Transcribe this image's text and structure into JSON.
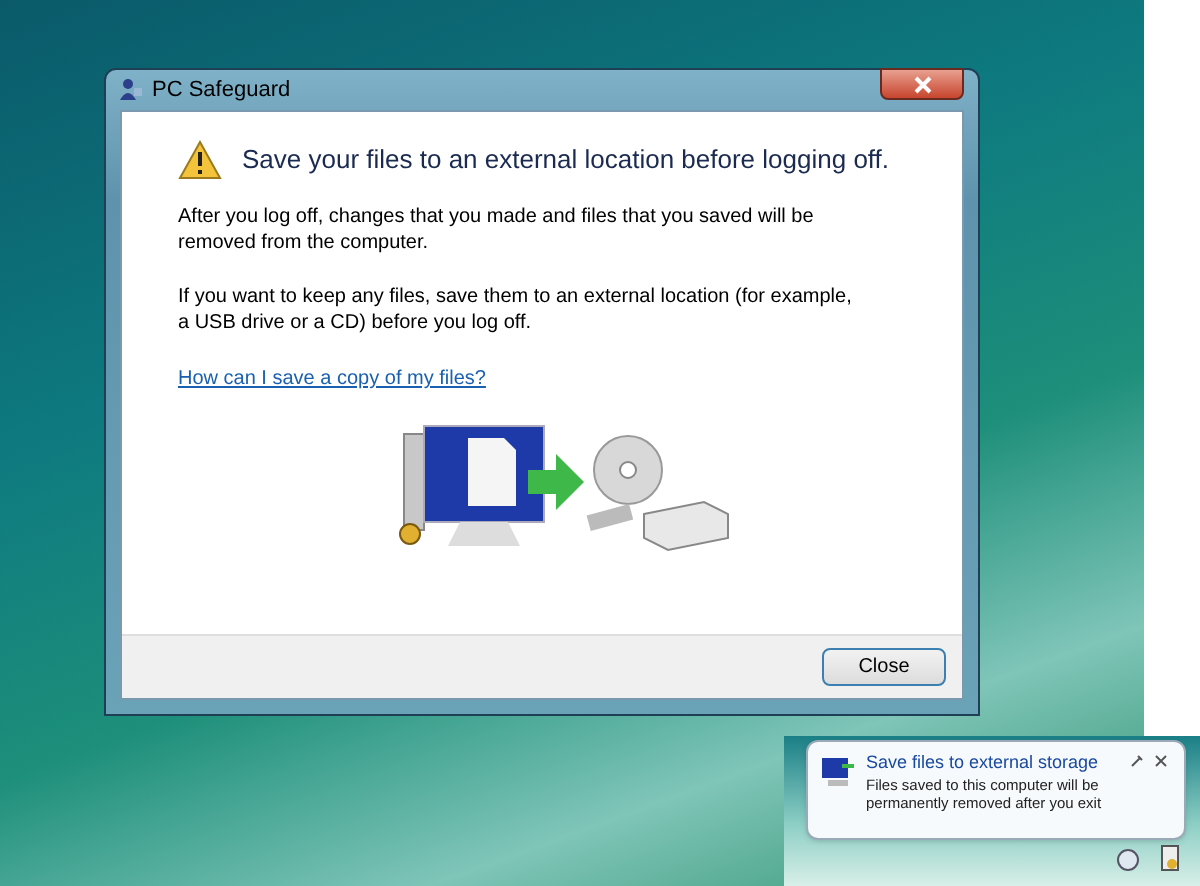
{
  "dialog": {
    "title": "PC Safeguard",
    "heading": "Save your files to an external location before logging off.",
    "paragraphs": [
      "After  you log off, changes that you made and files that you saved will be removed from the computer.",
      "If you want to keep any files, save them to an external location (for example, a USB drive or a CD) before you log off."
    ],
    "link": "How can I save a copy of my files?",
    "buttons": [
      "Close"
    ]
  },
  "notification": {
    "title": "Save files to external storage",
    "message": "Files saved to this computer will be permanently removed after you exit"
  }
}
